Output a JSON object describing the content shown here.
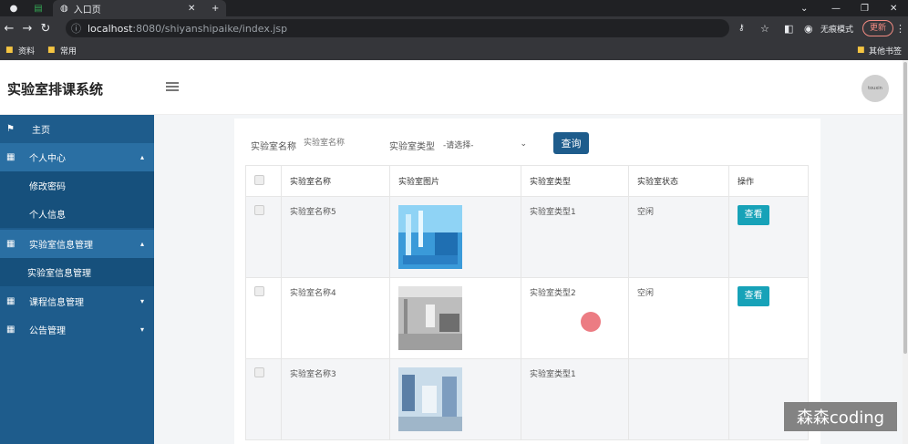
{
  "browser": {
    "tab_active": "入口页",
    "url_host": "localhost",
    "url_rest": ":8080/shiyanshipaike/index.jsp",
    "incognito_label": "无痕模式",
    "update_label": "更新",
    "bookmarks": [
      "资料",
      "常用"
    ],
    "other_bookmarks": "其他书签"
  },
  "app": {
    "title": "实验室排课系统",
    "avatar_text": "touxin"
  },
  "sidebar": {
    "items": [
      {
        "label": "主页",
        "icon": "flag-icon"
      },
      {
        "label": "个人中心",
        "icon": "grid-icon"
      },
      {
        "label": "修改密码"
      },
      {
        "label": "个人信息"
      },
      {
        "label": "实验室信息管理",
        "icon": "grid-icon"
      },
      {
        "label": "实验室信息管理"
      },
      {
        "label": "课程信息管理",
        "icon": "grid-icon"
      },
      {
        "label": "公告管理",
        "icon": "grid-icon"
      }
    ]
  },
  "search": {
    "name_label": "实验室名称",
    "name_placeholder": "实验室名称",
    "type_label": "实验室类型",
    "type_selected": "-请选择-",
    "query_button": "查询"
  },
  "table": {
    "headers": [
      "实验室名称",
      "实验室图片",
      "实验室类型",
      "实验室状态",
      "操作"
    ],
    "rows": [
      {
        "name": "实验室名称5",
        "type": "实验室类型1",
        "status": "空闲",
        "action": "查看"
      },
      {
        "name": "实验室名称4",
        "type": "实验室类型2",
        "status": "空闲",
        "action": "查看"
      },
      {
        "name": "实验室名称3",
        "type": "实验室类型1",
        "status": "",
        "action": ""
      }
    ]
  },
  "watermark": "森森coding",
  "colors": {
    "sidebar": "#1e5c8c",
    "primary_button": "#1e5c8c",
    "view_button": "#17a2b8"
  }
}
